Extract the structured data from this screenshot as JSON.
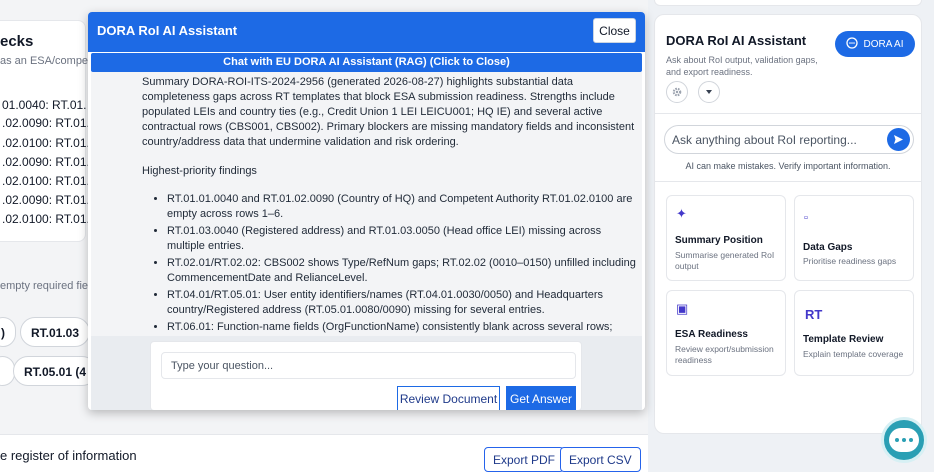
{
  "background": {
    "heading": "ecks",
    "subheading": "as an ESA/compet",
    "rows": [
      "01.0040: RT.01.",
      ".02.0090: RT.01.",
      ".02.0100: RT.01.",
      ".02.0090: RT.01.",
      ".02.0100: RT.01.",
      ".02.0090: RT.01.",
      ".02.0100: RT.01."
    ],
    "empty_note": "empty required fie",
    "chips": [
      ")",
      "RT.01.03",
      "RT.05.01 (4"
    ],
    "register_title": "e register of information",
    "export_pdf": "Export PDF",
    "export_csv": "Export CSV"
  },
  "right_panel": {
    "title": "DORA RoI AI Assistant",
    "description": "Ask about RoI output, validation gaps, and export readiness.",
    "dora_ai_button": "DORA AI",
    "ask_placeholder": "Ask anything about RoI reporting...",
    "disclaimer": "AI can make mistakes. Verify important information.",
    "cards": [
      {
        "icon": "sparkle-icon",
        "glyph": "✦",
        "title": "Summary Position",
        "desc": "Summarise generated RoI output"
      },
      {
        "icon": "square-icon",
        "glyph": "▫",
        "title": "Data Gaps",
        "desc": "Prioritise readiness gaps"
      },
      {
        "icon": "document-icon",
        "glyph": "▣",
        "title": "ESA Readiness",
        "desc": "Review export/submission readiness"
      },
      {
        "icon": "rt-icon",
        "glyph": "RT",
        "title": "Template Review",
        "desc": "Explain template coverage"
      }
    ]
  },
  "modal": {
    "title": "DORA RoI AI Assistant",
    "close_label": "Close",
    "chat_bar": "Chat with EU DORA AI Assistant (RAG) (Click to Close)",
    "summary": "Summary DORA-ROI-ITS-2024-2956 (generated 2026-08-27) highlights substantial data completeness gaps across RT templates that block ESA submission readiness. Strengths include populated LEIs and country ties (e.g., Credit Union 1 LEI LEICU001; HQ IE) and several active contractual rows (CBS001, CBS002). Primary blockers are missing mandatory fields and inconsistent country/address data that undermine validation and risk ordering.",
    "findings_heading": "Highest-priority findings",
    "findings": [
      "RT.01.01.0040 and RT.01.02.0090 (Country of HQ) and Competent Authority RT.01.02.0100 are empty across rows 1–6.",
      "RT.01.03.0040 (Registered address) and RT.01.03.0050 (Head office LEI) missing across multiple entries.",
      "RT.02.01/RT.02.02: CBS002 shows Type/RefNum gaps; RT.02.02 (0010–0150) unfilled including CommencementDate and RelianceLevel.",
      "RT.04.01/RT.05.01: User entity identifiers/names (RT.04.01.0030/0050) and Headquarters country/Registered address (RT.05.01.0080/0090) missing for several entries.",
      "RT.06.01: Function-name fields (OrgFunctionName) consistently blank across several rows;"
    ],
    "question_placeholder": "Type your question...",
    "review_label": "Review Document",
    "answer_label": "Get Answer"
  }
}
